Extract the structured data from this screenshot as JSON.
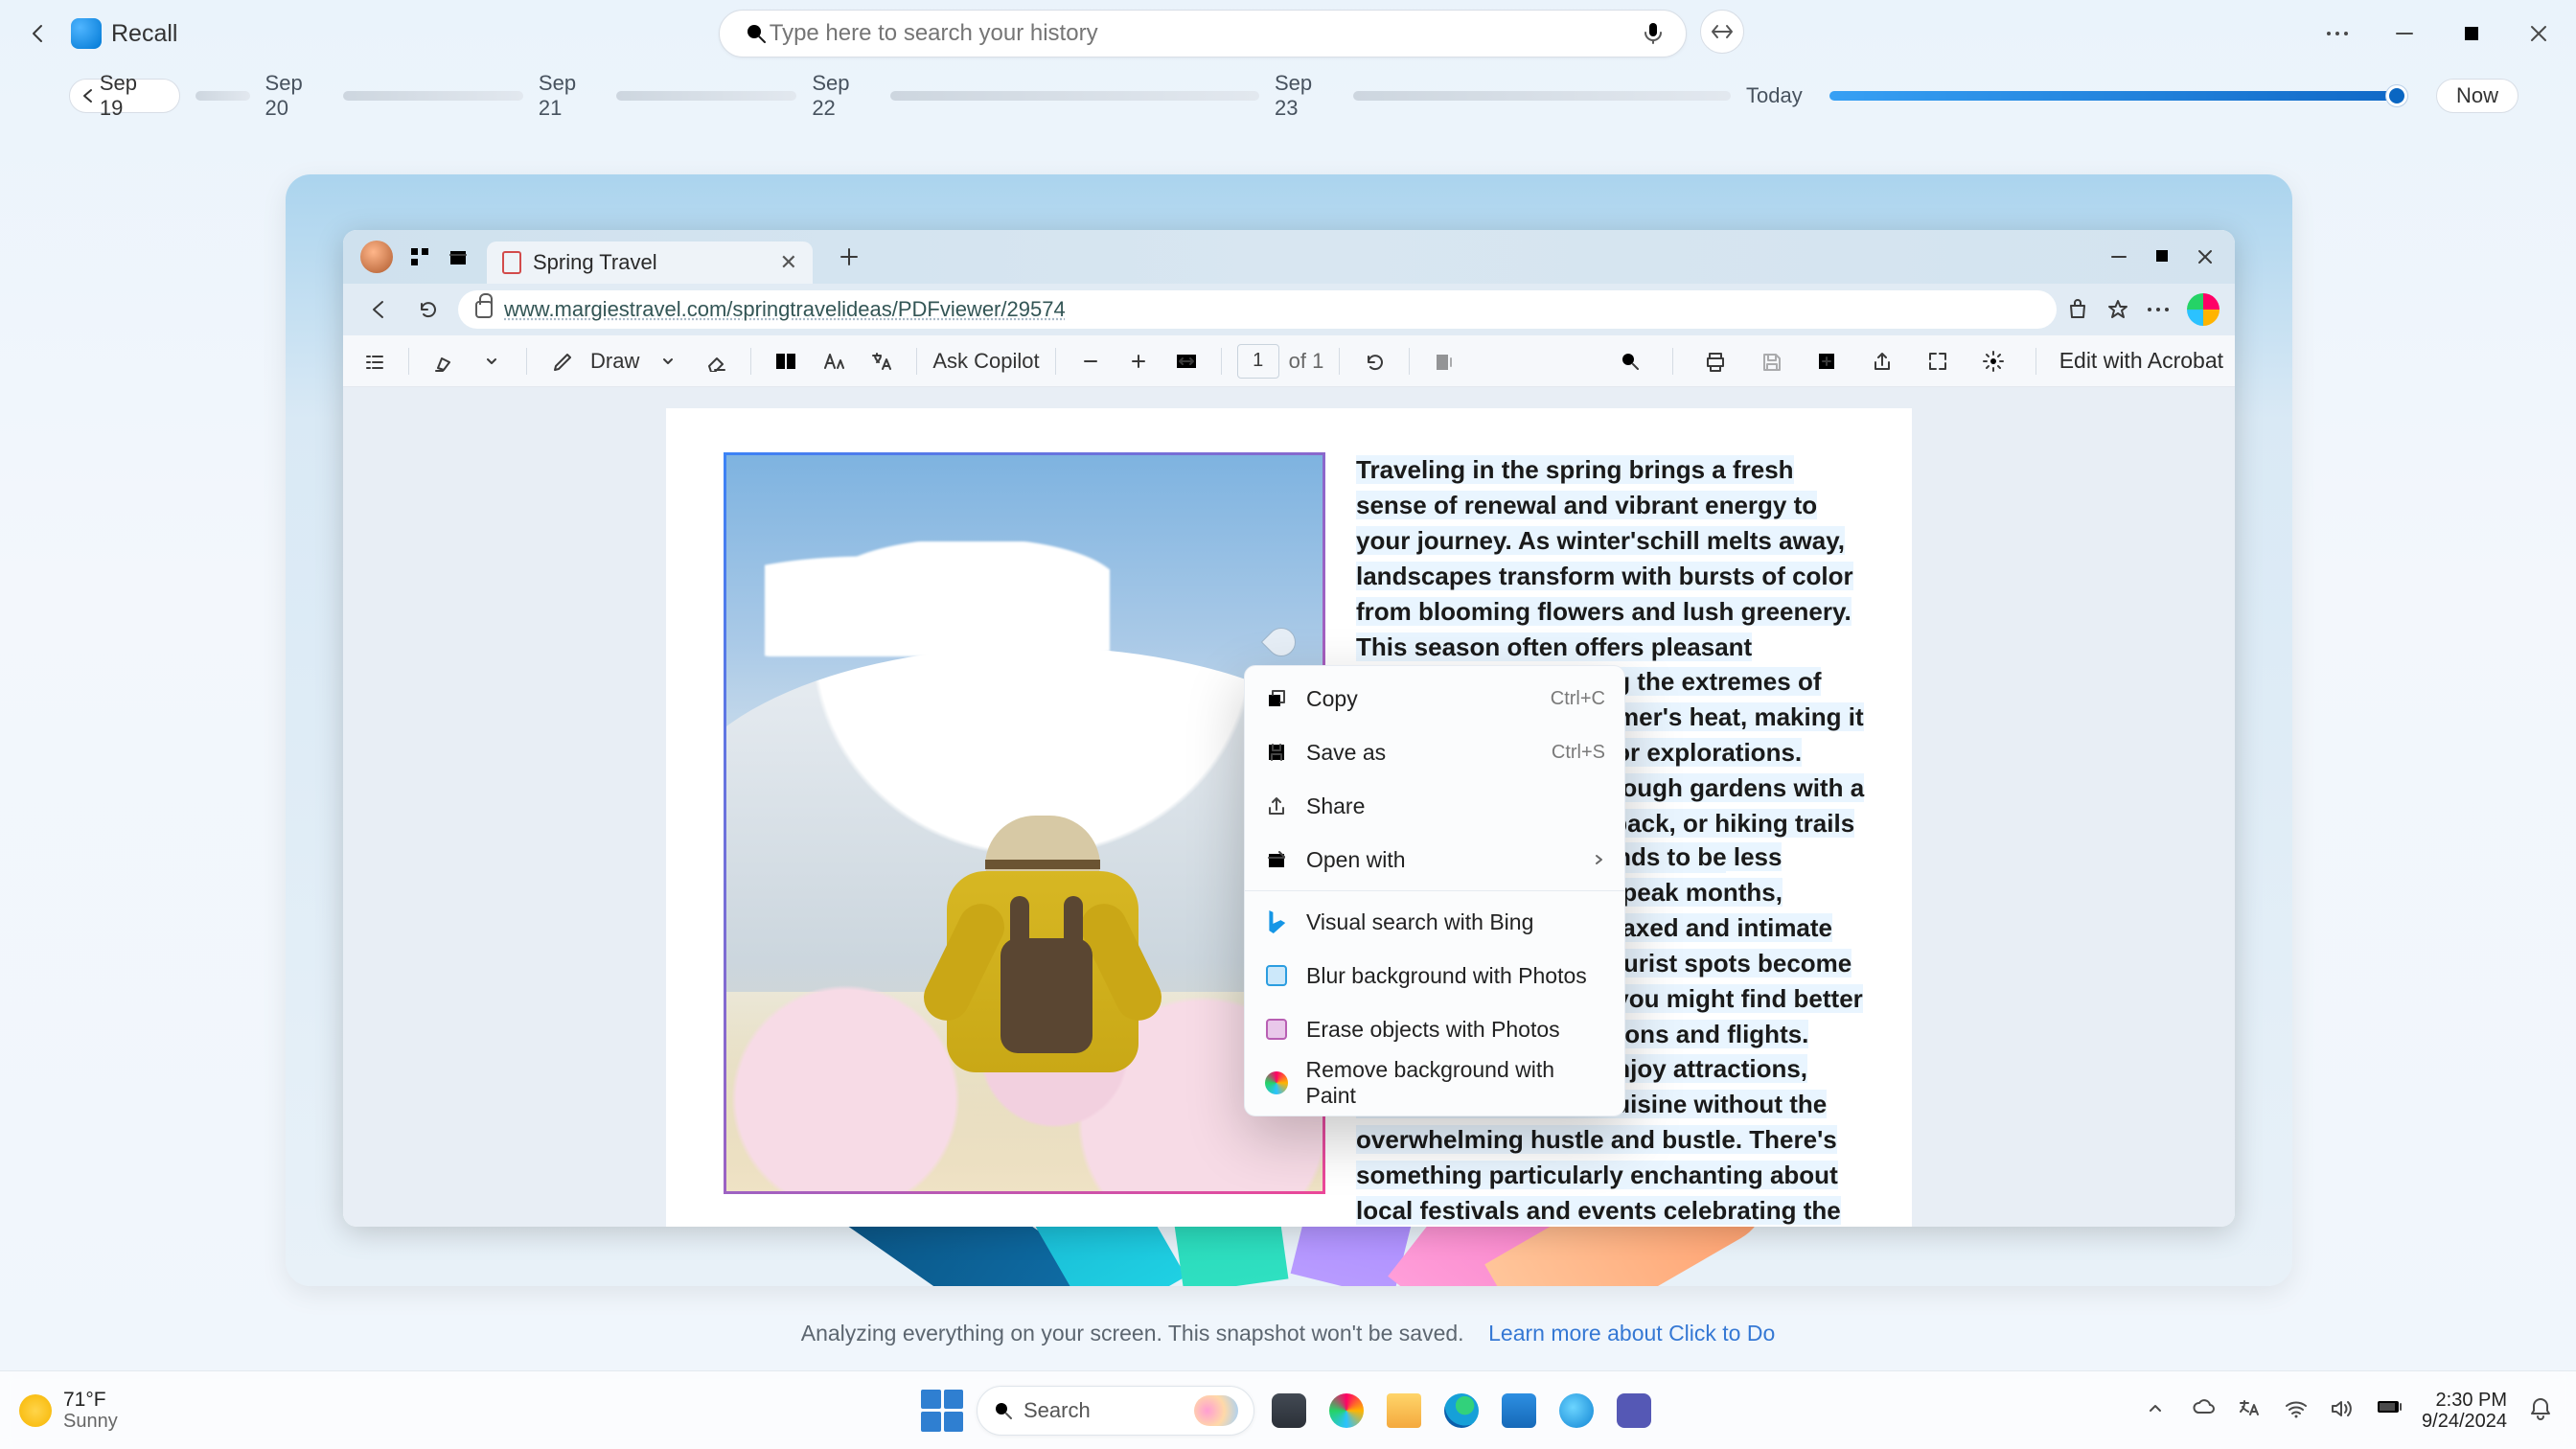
{
  "app": {
    "title": "Recall"
  },
  "search": {
    "placeholder": "Type here to search your history"
  },
  "timeline": {
    "start": "Sep 19",
    "dates": [
      "Sep 20",
      "Sep 21",
      "Sep 22",
      "Sep 23"
    ],
    "today": "Today",
    "now": "Now"
  },
  "edge": {
    "tab_name": "Spring Travel",
    "url": "www.margiestravel.com/springtravelideas/PDFviewer/29574"
  },
  "pdf": {
    "toolbar": {
      "draw": "Draw",
      "ask_copilot": "Ask Copilot",
      "edit_acrobat": "Edit with Acrobat",
      "page_current": "1",
      "page_total": "of 1"
    },
    "para1": "Traveling in the spring brings a fresh sense of renewal and vibrant energy to your journey. As winter'schill melts away, landscapes transform with bursts of color from blooming flowers and lush greenery. This season often offers pleasant temperatures, avoiding the extremes of winter's cold and summer's heat, making it comfortable for outdoor explorations. Imagine wandering through gardens with a gentle breeze at your back, or hiking trails surrounded by nature's rebirth.",
    "para2": "Additionally, spring tends to be less crowded compared to peak months, allowing for a more relaxed and intimate experience. Popular tourist spots become more accessible, and you might find better deals on accommodations and flights. This means you can enjoy attractions, museums, and local cuisine without the overwhelming hustle and bustle. There's something particularly enchanting about local festivals and events celebrating the arrival of spring, which provide a deeper connection to the culture and traditions of the place you're visiting."
  },
  "context_menu": {
    "copy": "Copy",
    "copy_sc": "Ctrl+C",
    "save_as": "Save as",
    "save_sc": "Ctrl+S",
    "share": "Share",
    "open_with": "Open with",
    "visual_search": "Visual search with Bing",
    "blur": "Blur background with Photos",
    "erase": "Erase objects with Photos",
    "remove_bg": "Remove background with Paint"
  },
  "footer": {
    "text": "Analyzing everything on your screen. This snapshot won't be saved.",
    "link": "Learn more about Click to Do"
  },
  "taskbar": {
    "weather_temp": "71°F",
    "weather_cond": "Sunny",
    "search": "Search",
    "time": "2:30 PM",
    "date": "9/24/2024"
  }
}
